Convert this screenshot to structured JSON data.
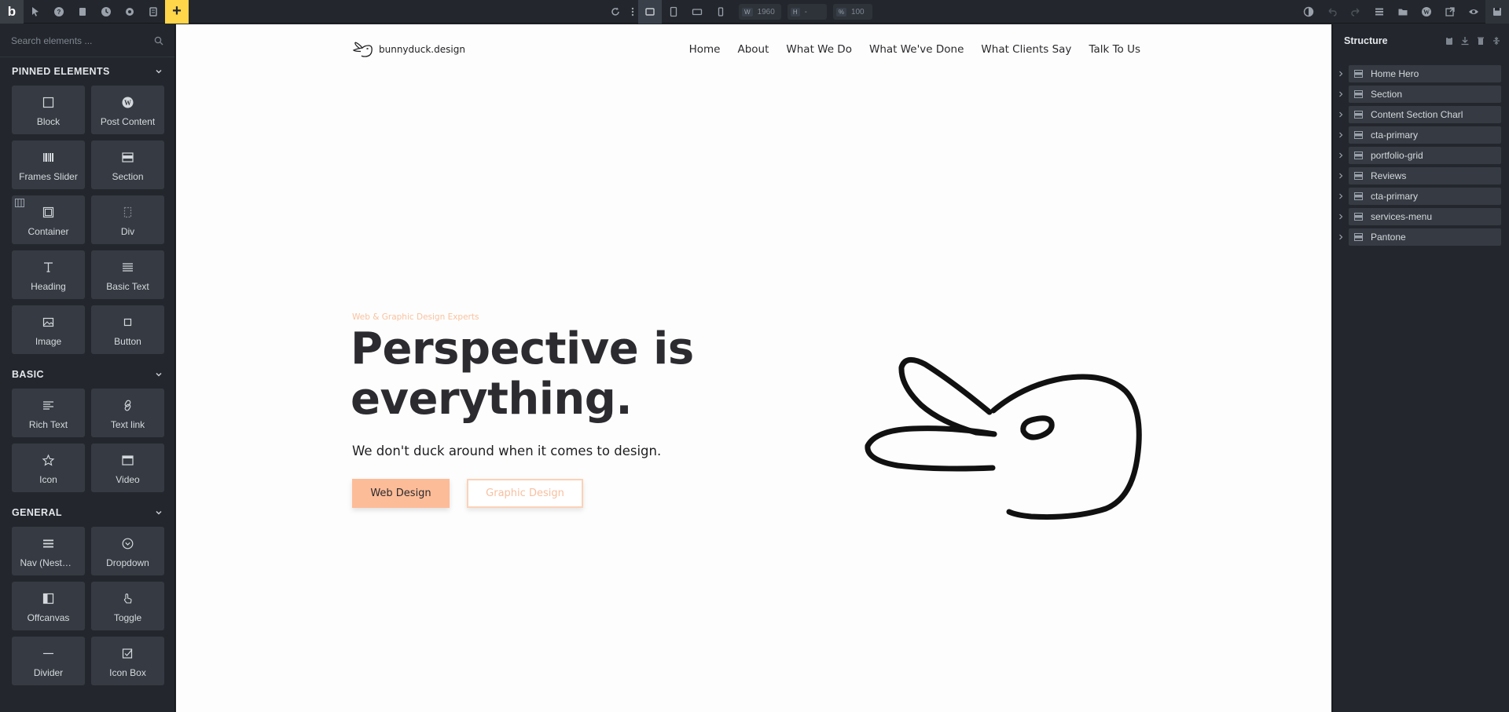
{
  "topbar": {
    "logo": "b",
    "dimensions": {
      "w_label": "W",
      "w_value": "1960",
      "h_label": "H",
      "h_value": "-",
      "zoom_label": "%",
      "zoom_value": "100"
    }
  },
  "left_panel": {
    "search_placeholder": "Search elements ...",
    "categories": [
      {
        "title": "PINNED ELEMENTS",
        "items": [
          {
            "label": "Block",
            "icon": "square-icon"
          },
          {
            "label": "Post Content",
            "icon": "wordpress-icon"
          },
          {
            "label": "Frames Slider",
            "icon": "barcode-icon"
          },
          {
            "label": "Section",
            "icon": "section-icon"
          },
          {
            "label": "Container",
            "icon": "container-icon"
          },
          {
            "label": "Div",
            "icon": "div-icon"
          },
          {
            "label": "Heading",
            "icon": "heading-icon"
          },
          {
            "label": "Basic Text",
            "icon": "text-lines-icon"
          },
          {
            "label": "Image",
            "icon": "image-icon"
          },
          {
            "label": "Button",
            "icon": "button-icon"
          }
        ]
      },
      {
        "title": "BASIC",
        "items": [
          {
            "label": "Rich Text",
            "icon": "rich-text-icon"
          },
          {
            "label": "Text link",
            "icon": "link-icon"
          },
          {
            "label": "Icon",
            "icon": "star-icon"
          },
          {
            "label": "Video",
            "icon": "video-icon"
          }
        ]
      },
      {
        "title": "GENERAL",
        "items": [
          {
            "label": "Nav (Nestable)",
            "icon": "menu-icon"
          },
          {
            "label": "Dropdown",
            "icon": "dropdown-icon"
          },
          {
            "label": "Offcanvas",
            "icon": "offcanvas-icon"
          },
          {
            "label": "Toggle",
            "icon": "toggle-icon"
          },
          {
            "label": "Divider",
            "icon": "divider-icon"
          },
          {
            "label": "Icon Box",
            "icon": "checkbox-icon"
          }
        ]
      }
    ]
  },
  "canvas": {
    "brand": "bunnyduck.design",
    "nav": [
      "Home",
      "About",
      "What We Do",
      "What We've Done",
      "What Clients Say",
      "Talk To Us"
    ],
    "eyebrow": "Web & Graphic Design Experts",
    "title_line1": "Perspective is",
    "title_line2": "everything.",
    "subtitle": "We don't duck around when it comes to design.",
    "primary_button": "Web Design",
    "secondary_button": "Graphic Design",
    "colors": {
      "accent": "#fdbc98",
      "text": "#2b2b30"
    }
  },
  "structure_panel": {
    "title": "Structure",
    "items": [
      "Home Hero",
      "Section",
      "Content Section Charl",
      "cta-primary",
      "portfolio-grid",
      "Reviews",
      "cta-primary",
      "services-menu",
      "Pantone"
    ]
  }
}
